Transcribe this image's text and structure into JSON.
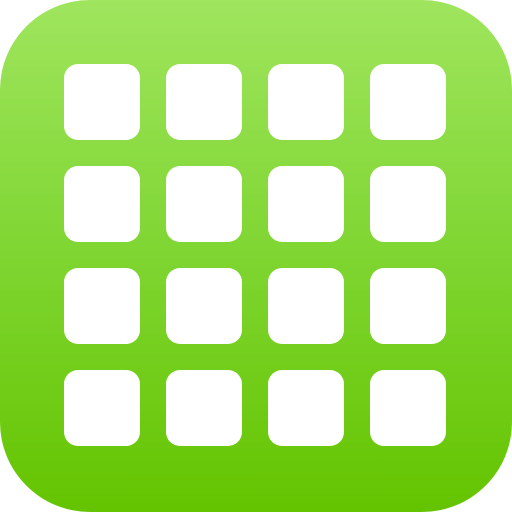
{
  "icon": {
    "name": "app-grid-icon",
    "shape": "rounded-square",
    "gradient_top": "#9fe55e",
    "gradient_bottom": "#64c400",
    "tile_color": "#ffffff"
  },
  "grid": {
    "rows": 4,
    "columns": 4
  }
}
